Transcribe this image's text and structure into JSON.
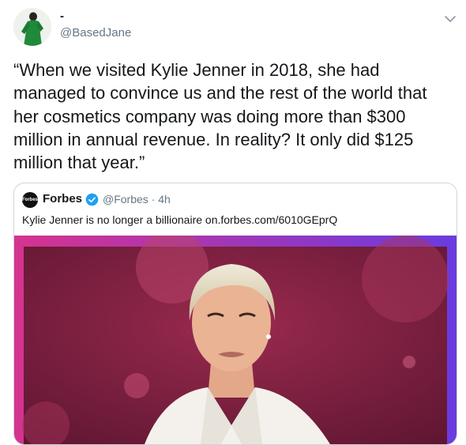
{
  "tweet": {
    "display_name": "-",
    "handle": "@BasedJane",
    "text": "“When we visited Kylie Jenner in 2018, she had\nmanaged to convince us and the rest of the world that\nher cosmetics company was doing more than $300\nmillion in annual revenue. In reality? It only did $125\nmillion that year.”",
    "menu_icon": "chevron-down-icon"
  },
  "quoted_tweet": {
    "avatar_text": "Forbes",
    "name": "Forbes",
    "verified_icon": "verified-badge-icon",
    "meta": "@Forbes · 4h",
    "text": "Kylie Jenner is no longer a billionaire on.forbes.com/6010GEprQ",
    "media_description": "photo"
  },
  "colors": {
    "text_primary": "#14171a",
    "text_secondary": "#657786",
    "border": "#ccd6dd",
    "verified_blue": "#1da1f2",
    "media_bg": "#7a1c3c",
    "media_frame_left": "#d6338f",
    "media_frame_right": "#6a3be0"
  }
}
